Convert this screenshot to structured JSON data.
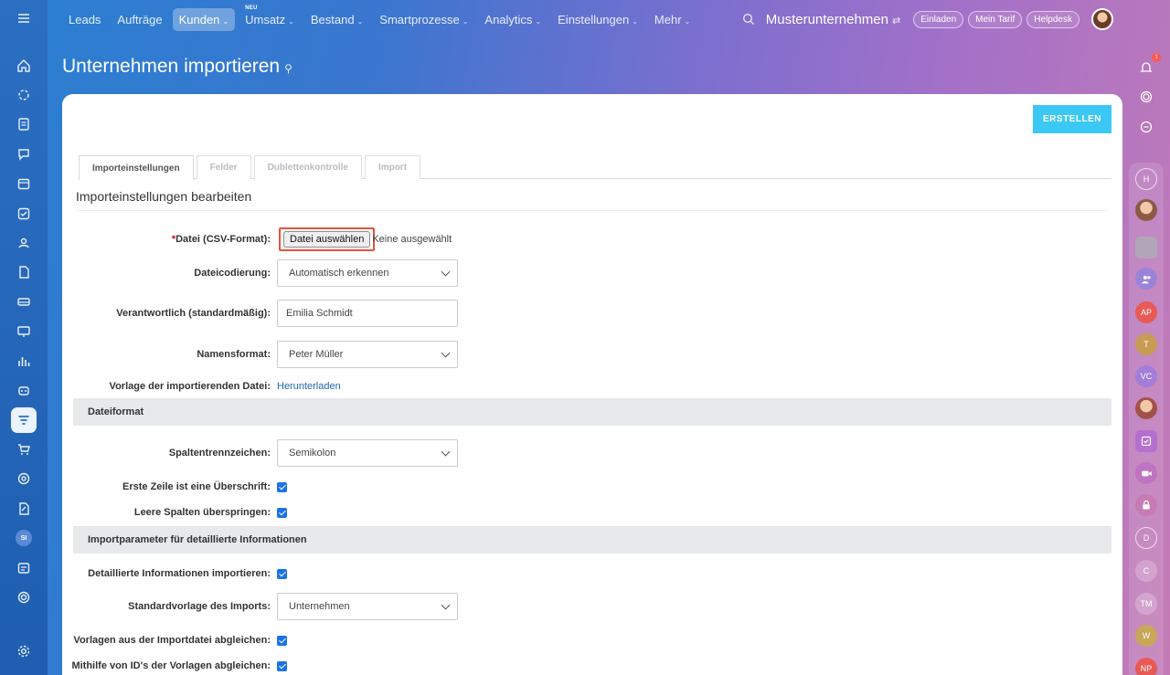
{
  "topbar": {
    "nav": [
      {
        "label": "Leads",
        "chevron": false,
        "active": false,
        "tag": ""
      },
      {
        "label": "Aufträge",
        "chevron": false,
        "active": false,
        "tag": ""
      },
      {
        "label": "Kunden",
        "chevron": true,
        "active": true,
        "tag": ""
      },
      {
        "label": "Umsatz",
        "chevron": true,
        "active": false,
        "tag": "NEU"
      },
      {
        "label": "Bestand",
        "chevron": true,
        "active": false,
        "tag": ""
      },
      {
        "label": "Smartprozesse",
        "chevron": true,
        "active": false,
        "tag": ""
      },
      {
        "label": "Analytics",
        "chevron": true,
        "active": false,
        "tag": ""
      },
      {
        "label": "Einstellungen",
        "chevron": true,
        "active": false,
        "tag": ""
      },
      {
        "label": "Mehr",
        "chevron": true,
        "active": false,
        "tag": ""
      }
    ],
    "company": "Musterunternehmen",
    "invite_label": "Einladen",
    "plan_label": "Mein Tarif",
    "helpdesk_label": "Helpdesk"
  },
  "page": {
    "title": "Unternehmen importieren",
    "create_button": "ERSTELLEN"
  },
  "tabs": [
    "Importeinstellungen",
    "Felder",
    "Dublettenkontrolle",
    "Import"
  ],
  "form": {
    "heading": "Importeinstellungen bearbeiten",
    "file_label": "Datei (CSV-Format):",
    "file_required_mark": "*",
    "file_button": "Datei auswählen",
    "file_status": "Keine ausgewählt",
    "encoding_label": "Dateicodierung:",
    "encoding_value": "Automatisch erkennen",
    "responsible_label": "Verantwortlich (standardmäßig):",
    "responsible_value": "Emilia Schmidt",
    "nameformat_label": "Namensformat:",
    "nameformat_value": "Peter Müller",
    "template_label": "Vorlage der importierenden Datei:",
    "template_link": "Herunterladen",
    "section_fileformat": "Dateiformat",
    "separator_label": "Spaltentrennzeichen:",
    "separator_value": "Semikolon",
    "firstrow_label": "Erste Zeile ist eine Überschrift:",
    "skipempty_label": "Leere Spalten überspringen:",
    "section_details": "Importparameter für detaillierte Informationen",
    "details_label": "Detaillierte Informationen importieren:",
    "default_template_label": "Standardvorlage des Imports:",
    "default_template_value": "Unternehmen",
    "match_templates_label": "Vorlagen aus der Importdatei abgleichen:",
    "match_ids_label": "Mithilfe von ID's der Vorlagen abgleichen:"
  },
  "sidebar_left": {
    "user_initials": "SI"
  },
  "sidebar_right": {
    "notification_count": "1",
    "contacts": [
      "H",
      "AP",
      "T",
      "VC",
      "D",
      "C",
      "TM",
      "W",
      "NP"
    ]
  }
}
